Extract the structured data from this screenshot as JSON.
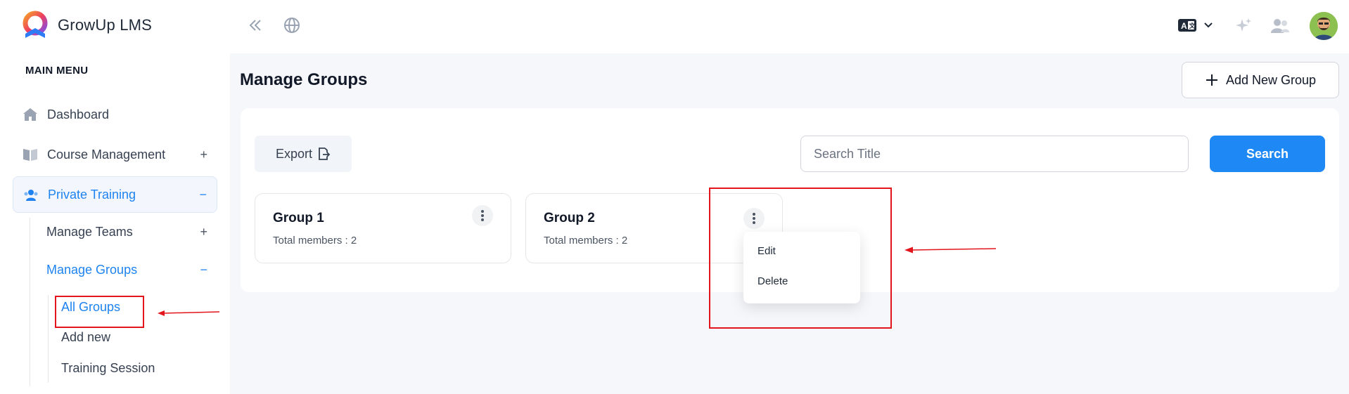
{
  "app": {
    "name": "GrowUp LMS"
  },
  "sidebar": {
    "menu_title": "MAIN MENU",
    "items": [
      {
        "label": "Dashboard",
        "icon": "home-icon",
        "sign": ""
      },
      {
        "label": "Course Management",
        "icon": "book-icon",
        "sign": "+"
      },
      {
        "label": "Private Training",
        "icon": "users-icon",
        "sign": "−"
      }
    ],
    "sub_items": [
      {
        "label": "Manage Teams",
        "sign": "+"
      },
      {
        "label": "Manage Groups",
        "sign": "−"
      }
    ],
    "leaf_items": [
      {
        "label": "All Groups"
      },
      {
        "label": "Add new"
      },
      {
        "label": "Training Session"
      }
    ]
  },
  "header": {
    "language_icon": "translate-icon",
    "icons": [
      "collapse-icon",
      "globe-icon",
      "sparkle-icon",
      "team-icon",
      "avatar"
    ]
  },
  "page": {
    "title": "Manage Groups",
    "add_button": "Add New Group",
    "export_button": "Export",
    "search_placeholder": "Search Title",
    "search_button": "Search"
  },
  "groups": [
    {
      "name": "Group 1",
      "members": "Total members : 2"
    },
    {
      "name": "Group 2",
      "members": "Total members : 2"
    }
  ],
  "dropdown": {
    "options": [
      "Edit",
      "Delete"
    ]
  },
  "colors": {
    "accent": "#1e88f5",
    "annotation": "#e3151c"
  }
}
